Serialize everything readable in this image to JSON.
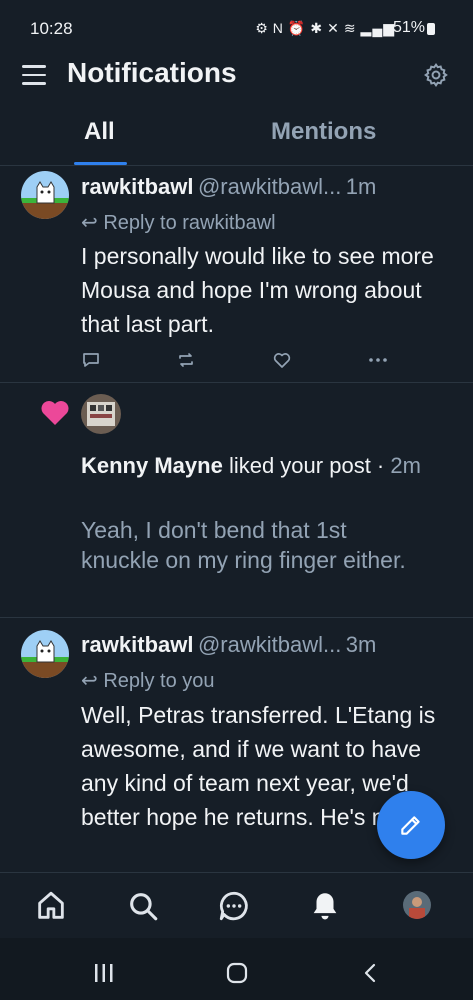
{
  "status_bar": {
    "time": "10:28",
    "battery": "51%"
  },
  "header": {
    "title": "Notifications"
  },
  "tabs": [
    {
      "label": "All",
      "active": true
    },
    {
      "label": "Mentions",
      "active": false
    }
  ],
  "notifications": [
    {
      "author": "rawkitbawl",
      "handle": "@rawkitbawl...",
      "time": "1m",
      "reply_to": "Reply to rawkitbawl",
      "text": "I personally would like to see more Mousa and hope I'm wrong about that last part."
    },
    {
      "author": "Kenny Mayne",
      "action": "liked your post ·",
      "time": "2m",
      "text": "Yeah, I don't bend that 1st knuckle on my ring finger either."
    },
    {
      "author": "rawkitbawl",
      "handle": "@rawkitbawl...",
      "time": "3m",
      "reply_to": "Reply to you",
      "text": "Well, Petras transferred. L'Etang is awesome, and if we want to have any kind of team next year, we'd better hope he returns. He's not"
    }
  ],
  "colors": {
    "background": "#161e27",
    "accent": "#2f80ed",
    "like": "#ec4899",
    "muted": "#93a3b4"
  }
}
